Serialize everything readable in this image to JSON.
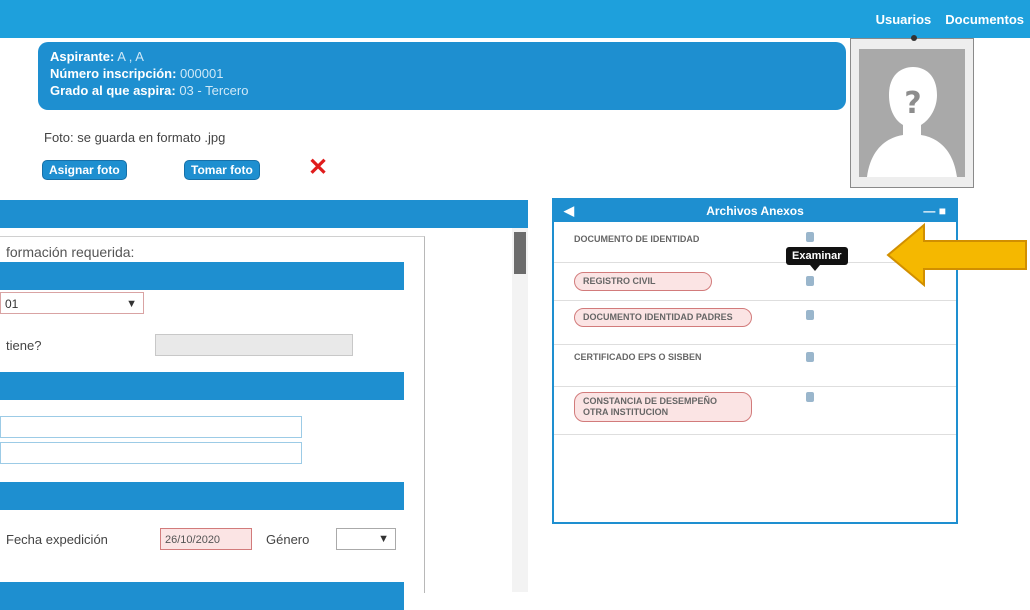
{
  "topbar": {
    "link1": "Usuarios",
    "link2": "Documentos"
  },
  "info": {
    "aspirante_label": "Aspirante:",
    "aspirante_value": "A , A",
    "inscripcion_label": "Número inscripción:",
    "inscripcion_value": "000001",
    "grado_label": "Grado al que aspira:",
    "grado_value": "03 - Tercero"
  },
  "foto": {
    "note": "Foto: se guarda en formato .jpg",
    "assign_btn": "Asignar foto",
    "take_btn": "Tomar foto",
    "delete_icon": "close-icon"
  },
  "form": {
    "required_text": "formación requerida:",
    "select1_value": "01",
    "question_label": "tiene?",
    "fecha_label": "Fecha expedición",
    "fecha_value": "26/10/2020",
    "genero_label": "Género"
  },
  "archivos": {
    "title": "Archivos Anexos",
    "tooltip": "Examinar",
    "items": [
      {
        "label": "DOCUMENTO DE IDENTIDAD",
        "highlighted": false
      },
      {
        "label": "REGISTRO CIVIL",
        "highlighted": true
      },
      {
        "label": "DOCUMENTO IDENTIDAD PADRES",
        "highlighted": true
      },
      {
        "label": "CERTIFICADO EPS O SISBEN",
        "highlighted": false
      },
      {
        "label": "CONSTANCIA DE DESEMPEÑO OTRA INSTITUCION",
        "highlighted": true
      }
    ]
  },
  "colors": {
    "primary": "#1e8fd0",
    "topbar": "#1ea0dc",
    "required_pink": "#fbe4e4",
    "arrow": "#f5b800",
    "delete_red": "#e01c1c"
  }
}
